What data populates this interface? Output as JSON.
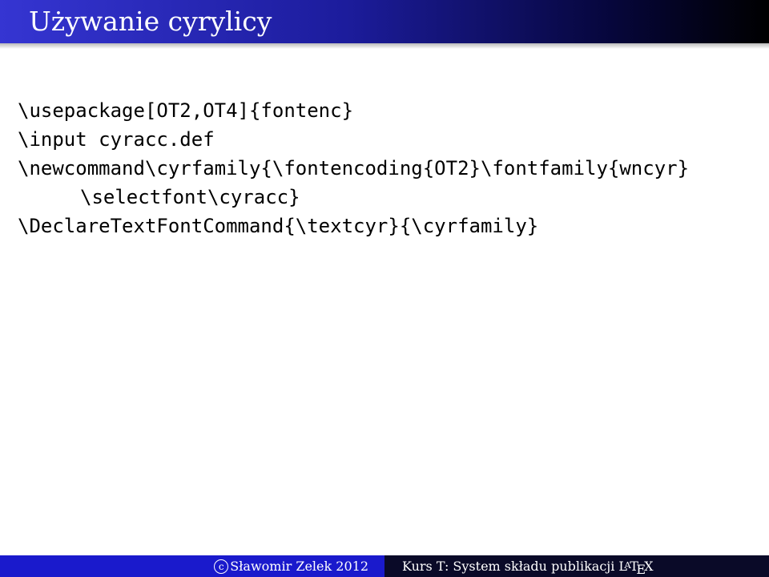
{
  "slide": {
    "title": "Używanie cyrylicy"
  },
  "code": {
    "lines": [
      "\\usepackage[OT2,OT4]{fontenc}",
      "\\input cyracc.def",
      "\\newcommand\\cyrfamily{\\fontencoding{OT2}\\fontfamily{wncyr}",
      "\\selectfont\\cyracc}",
      "\\DeclareTextFontCommand{\\textcyr}{\\cyrfamily}"
    ]
  },
  "footer": {
    "copyright_symbol": "c",
    "author": "Sławomir Zelek 2012",
    "course": "Kurs T: System składu publikacji",
    "latex_logo": {
      "l": "L",
      "a": "A",
      "t": "T",
      "e": "E",
      "x": "X"
    }
  },
  "colors": {
    "title_bar_start": "#3535d2",
    "title_bar_end": "#000000",
    "footer_left_bg": "#1a1acc",
    "footer_right_bg": "#0a0a28",
    "text_on_dark": "#ffffff",
    "body_text": "#000000"
  }
}
